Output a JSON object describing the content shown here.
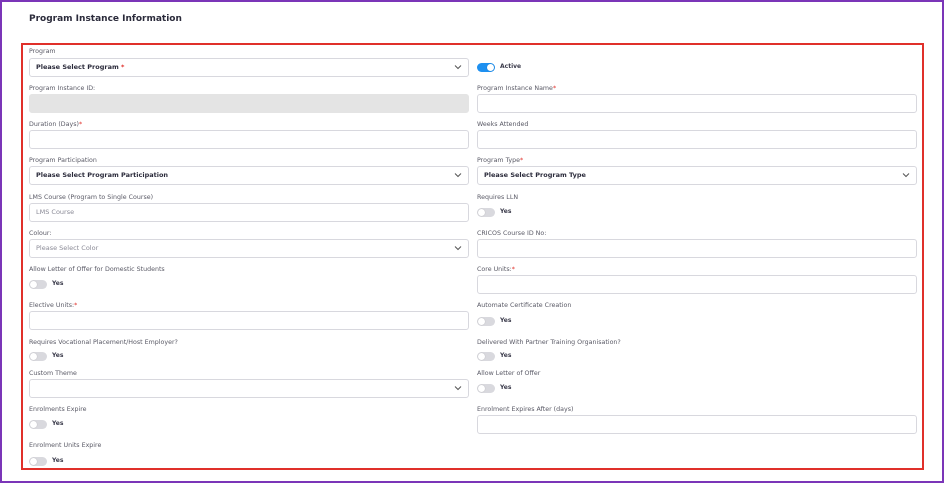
{
  "section": {
    "title": "Program Instance Information"
  },
  "fields": {
    "program": {
      "label": "Program",
      "placeholder": "Please Select Program",
      "required_mark": "*"
    },
    "active": {
      "label": "Active",
      "on": true
    },
    "instance_id": {
      "label": "Program Instance ID:"
    },
    "instance_name": {
      "label": "Program Instance Name",
      "required_mark": "*"
    },
    "duration": {
      "label": "Duration (Days)",
      "required_mark": "*"
    },
    "weeks_attended": {
      "label": "Weeks Attended"
    },
    "participation": {
      "label": "Program Participation",
      "placeholder": "Please Select Program Participation"
    },
    "program_type": {
      "label": "Program Type",
      "required_mark": "*",
      "placeholder": "Please Select Program Type"
    },
    "lms_course": {
      "label": "LMS Course (Program to Single Course)",
      "placeholder": "LMS Course"
    },
    "requires_lln": {
      "label": "Requires LLN",
      "toggle_label": "Yes",
      "on": false
    },
    "colour": {
      "label": "Colour:",
      "placeholder": "Please Select Color"
    },
    "cricos": {
      "label": "CRICOS Course ID No:"
    },
    "allow_lo_domestic": {
      "label": "Allow Letter of Offer for Domestic Students",
      "toggle_label": "Yes",
      "on": false
    },
    "core_units": {
      "label": "Core Units:",
      "required_mark": "*"
    },
    "elective_units": {
      "label": "Elective Units:",
      "required_mark": "*"
    },
    "automate_cert": {
      "label": "Automate Certificate Creation",
      "toggle_label": "Yes",
      "on": false
    },
    "vocational": {
      "label": "Requires Vocational Placement/Host Employer?",
      "toggle_label": "Yes",
      "on": false
    },
    "partner_training": {
      "label": "Delivered With Partner Training Organisation?",
      "toggle_label": "Yes",
      "on": false
    },
    "custom_theme": {
      "label": "Custom Theme"
    },
    "allow_lo": {
      "label": "Allow Letter of Offer",
      "toggle_label": "Yes",
      "on": false
    },
    "enrolments_expire": {
      "label": "Enrolments Expire",
      "toggle_label": "Yes",
      "on": false
    },
    "enrolment_expires_after": {
      "label": "Enrolment Expires After (days)"
    },
    "enrolment_units_expire": {
      "label": "Enrolment Units Expire",
      "toggle_label": "Yes",
      "on": false
    }
  },
  "colors": {
    "frame": "#7b35b8",
    "highlight": "#e0302a",
    "toggle_on": "#1e90f0"
  },
  "icons": {
    "dropdown": "chevron-down-icon"
  }
}
